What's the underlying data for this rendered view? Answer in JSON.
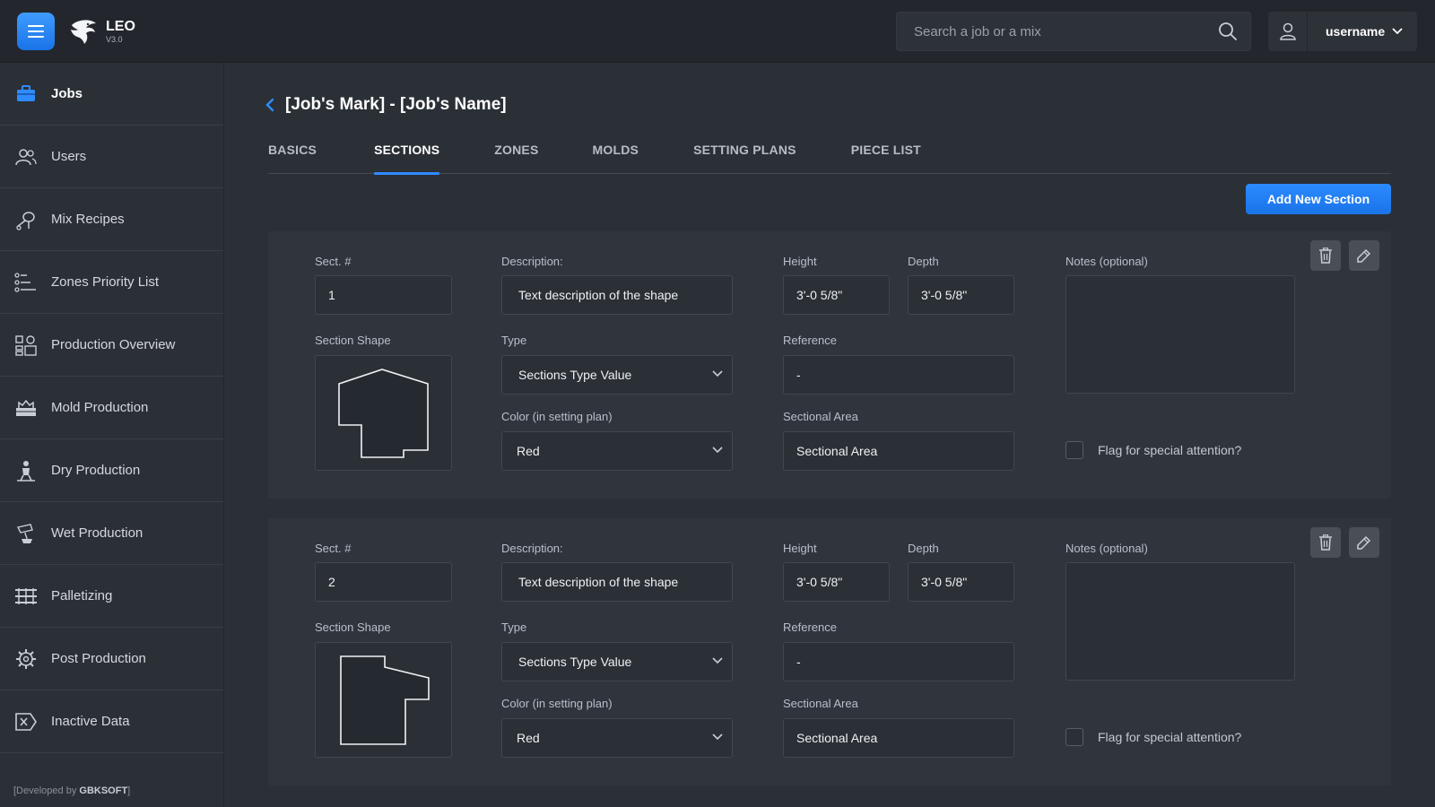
{
  "app": {
    "name": "LEO",
    "version": "V3.0",
    "search_placeholder": "Search a job or a mix",
    "username": "username",
    "dev_prefix": "[Developed by ",
    "dev_company": "GBKSOFT",
    "dev_suffix": "]"
  },
  "colors": {
    "accent": "#2f8cff",
    "bg": "#2b2f36",
    "card": "#30353d"
  },
  "sidebar": {
    "items": [
      {
        "label": "Jobs",
        "icon": "briefcase-icon",
        "active": true
      },
      {
        "label": "Users",
        "icon": "users-icon"
      },
      {
        "label": "Mix Recipes",
        "icon": "mixer-icon"
      },
      {
        "label": "Zones Priority List",
        "icon": "list-icon"
      },
      {
        "label": "Production Overview",
        "icon": "factory-icon"
      },
      {
        "label": "Mold Production",
        "icon": "mold-icon"
      },
      {
        "label": "Dry Production",
        "icon": "worker-icon"
      },
      {
        "label": "Wet Production",
        "icon": "pour-icon"
      },
      {
        "label": "Palletizing",
        "icon": "pallet-icon"
      },
      {
        "label": "Post Production",
        "icon": "gear-icon"
      },
      {
        "label": "Inactive Data",
        "icon": "archive-icon"
      }
    ]
  },
  "page": {
    "title": "[Job's Mark] - [Job's Name]",
    "tabs": [
      "BASICS",
      "SECTIONS",
      "ZONES",
      "MOLDS",
      "SETTING PLANS",
      "PIECE LIST"
    ],
    "active_tab": "SECTIONS",
    "add_button": "Add New Section"
  },
  "labels": {
    "sect": "Sect. #",
    "description": "Description:",
    "height": "Height",
    "depth": "Depth",
    "notes": "Notes (optional)",
    "section_shape": "Section Shape",
    "type": "Type",
    "reference": "Reference",
    "color": "Color (in setting plan)",
    "sectional_area": "Sectional Area",
    "flag": "Flag for special attention?"
  },
  "sections": [
    {
      "number": "1",
      "description": "Text description of the shape",
      "height": "3'-0 5/8\"",
      "depth": "3'-0 5/8\"",
      "type": "Sections Type Value",
      "reference": "-",
      "color": "Red",
      "sectional_area": "Sectional Area",
      "notes": ""
    },
    {
      "number": "2",
      "description": "Text description of the shape",
      "height": "3'-0 5/8\"",
      "depth": "3'-0 5/8\"",
      "type": "Sections Type Value",
      "reference": "-",
      "color": "Red",
      "sectional_area": "Sectional Area",
      "notes": ""
    }
  ]
}
